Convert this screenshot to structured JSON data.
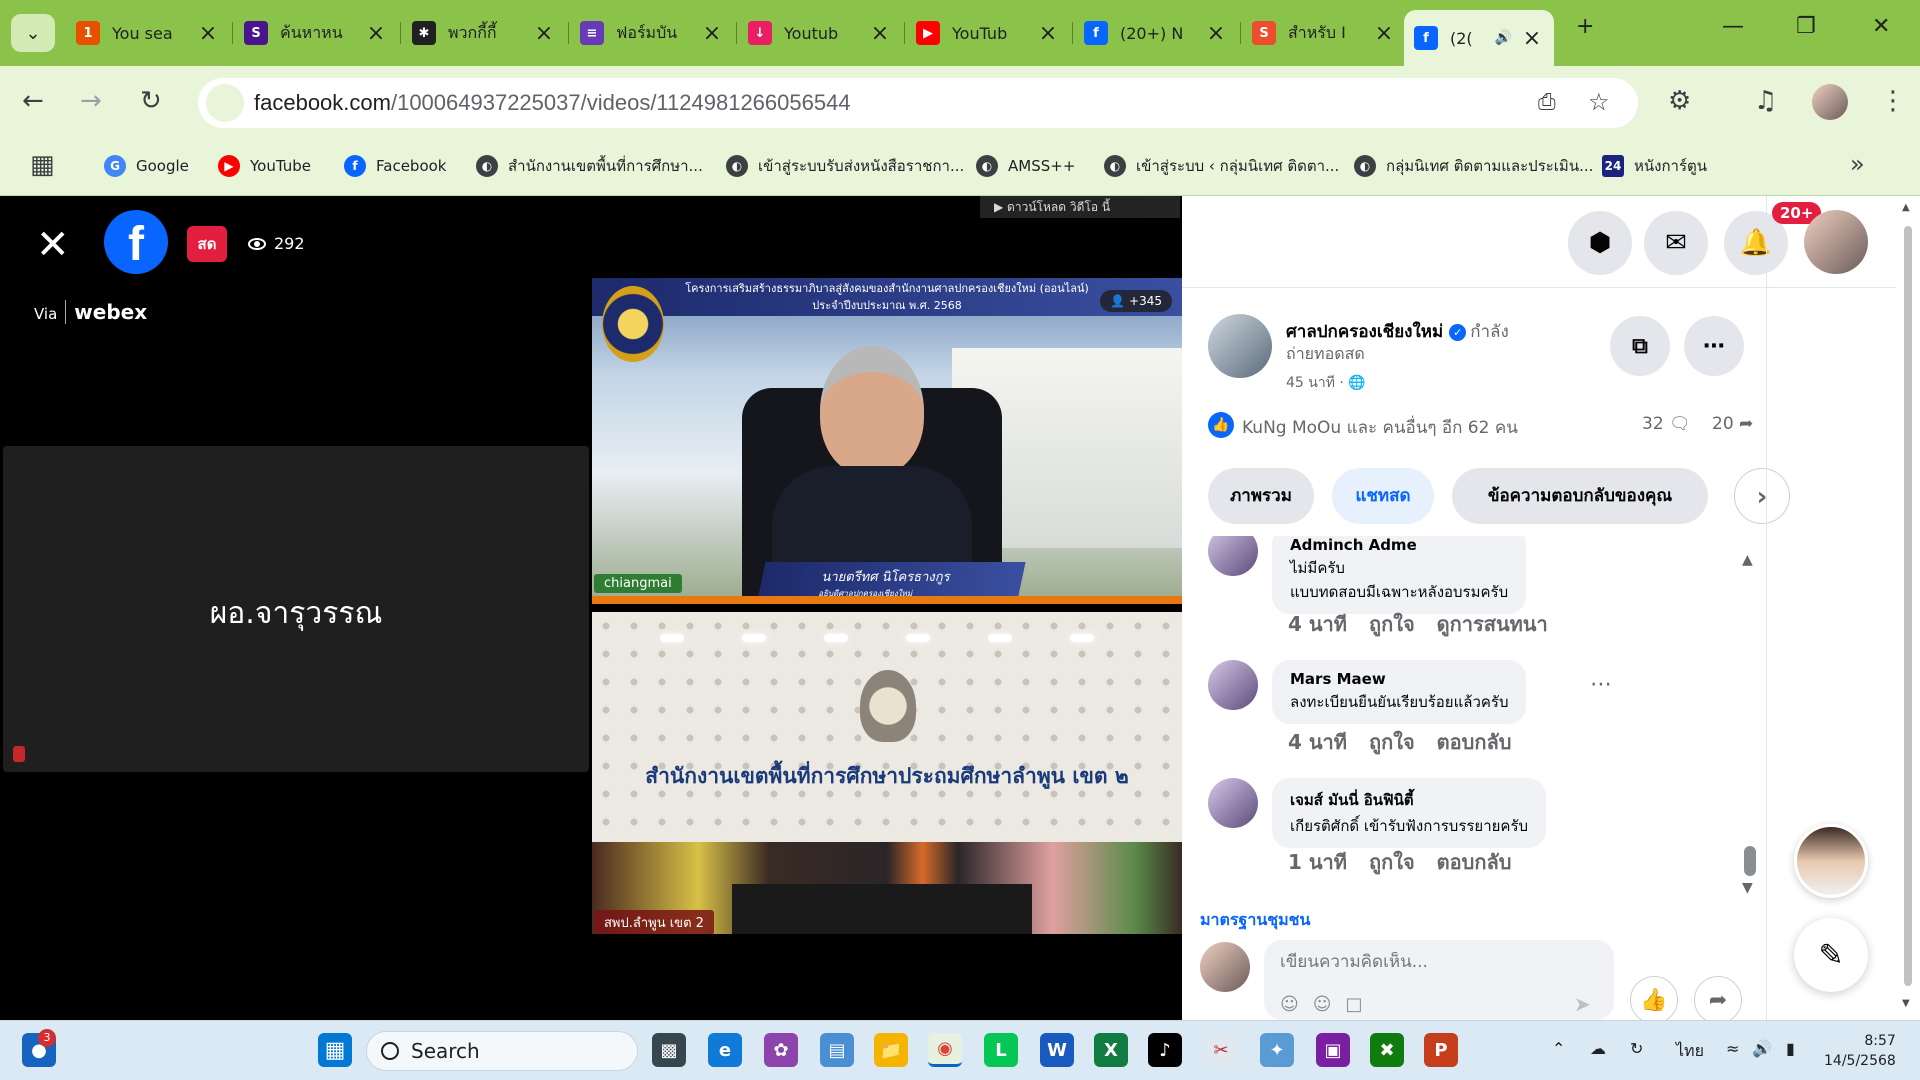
{
  "browser": {
    "tabs": [
      {
        "label": "You sea",
        "icon": "123hd-icon",
        "color": "#e65100"
      },
      {
        "label": "ค้นหาหน",
        "icon": "sd-icon",
        "color": "#4a148c"
      },
      {
        "label": "พวกกี้กี้",
        "icon": "spider-icon",
        "color": "#212121"
      },
      {
        "label": "ฟอร์มบัน",
        "icon": "forms-icon",
        "color": "#673ab7"
      },
      {
        "label": "Youtub",
        "icon": "download-icon",
        "color": "#e91e63"
      },
      {
        "label": "YouTub",
        "icon": "youtube-icon",
        "color": "#ff0000"
      },
      {
        "label": "(20+) N",
        "icon": "facebook-icon",
        "color": "#0866ff"
      },
      {
        "label": "สำหรับ I",
        "icon": "shopee-icon",
        "color": "#ee4d2d"
      },
      {
        "label": "(2(",
        "icon": "facebook-icon",
        "color": "#0866ff"
      }
    ],
    "url_domain": "facebook.com",
    "url_path": "/100064937225037/videos/1124981266056544",
    "bookmarks": [
      {
        "label": "Google",
        "icon": "google-icon",
        "color": "#4285f4"
      },
      {
        "label": "YouTube",
        "icon": "youtube-icon",
        "color": "#ff0000"
      },
      {
        "label": "Facebook",
        "icon": "facebook-icon",
        "color": "#0866ff"
      },
      {
        "label": "สำนักงานเขตพื้นที่การศึกษา...",
        "icon": "globe-icon",
        "color": "#3c4043"
      },
      {
        "label": "เข้าสู่ระบบรับส่งหนังสือราชกา...",
        "icon": "globe-icon",
        "color": "#3c4043"
      },
      {
        "label": "AMSS++",
        "icon": "globe-icon",
        "color": "#3c4043"
      },
      {
        "label": "เข้าสู่ระบบ ‹ กลุ่มนิเทศ ติดตา...",
        "icon": "globe-icon",
        "color": "#3c4043"
      },
      {
        "label": "กลุ่มนิเทศ ติดตามและประเมิน...",
        "icon": "globe-icon",
        "color": "#3c4043"
      },
      {
        "label": "หนังการ์ตูน",
        "icon": "24hd-icon",
        "color": "#1a237e"
      }
    ]
  },
  "video": {
    "live_label": "สด",
    "viewer_count": "292",
    "via_label": "Via",
    "webex_label": "webex",
    "participant_name": "ผอ.จารุวรรณ",
    "download_bar": "ดาวน์โหลด วิดีโอ นี้",
    "top_banner_line1": "โครงการเสริมสร้างธรรมาภิบาลสู่สังคมของสำนักงานศาลปกครองเชียงใหม่ (ออนไลน์)",
    "top_banner_line2": "ประจำปีงบประมาณ พ.ศ. 2568",
    "top_count": "+345",
    "speaker_name": "นายตรีทศ นิโครธางกูร",
    "speaker_title": "อธิบดีศาลปกครองเชียงใหม่",
    "top_location": "chiangmai",
    "bottom_title": "สำนักงานเขตพื้นที่การศึกษาประถมศึกษาลำพูน เขต ๒",
    "bottom_location": "สพป.ลำพูน เขต 2"
  },
  "header": {
    "notif_count": "20+"
  },
  "post": {
    "page_name": "ศาลปกครองเชียงใหม่",
    "status_inline": "กำลัง",
    "status_line2": "ถ่ายทอดสด",
    "time": "45 นาที ·",
    "reactions_text": "KuNg MoOu และ คนอื่นๆ อีก 62 คน",
    "comment_count": "32",
    "share_count": "20",
    "tabs": [
      "ภาพรวม",
      "แชทสด",
      "ข้อความตอบกลับของคุณ"
    ]
  },
  "comments": [
    {
      "author": "Adminch Adme",
      "lines": [
        "ไม่มีครับ",
        "แบบทดสอบมีเฉพาะหลังอบรมครับ"
      ],
      "time": "4 นาที",
      "like": "ถูกใจ",
      "action": "ดูการสนทนา"
    },
    {
      "author": "Mars Maew",
      "lines": [
        "ลงทะเบียนยืนยันเรียบร้อยแล้วครับ"
      ],
      "time": "4 นาที",
      "like": "ถูกใจ",
      "action": "ตอบกลับ"
    },
    {
      "author": "เจมส์ มันนี่ อินฟินิตี้",
      "lines": [
        "เกียรติศักดิ์ เข้ารับฟังการบรรยายครับ"
      ],
      "time": "1 นาที",
      "like": "ถูกใจ",
      "action": "ตอบกลับ"
    }
  ],
  "composer": {
    "standards_link": "มาตรฐานชุมชน",
    "placeholder": "เขียนความคิดเห็น..."
  },
  "taskbar": {
    "search_label": "Search",
    "notif_badge": "3",
    "lang": "ไทย",
    "time": "8:57",
    "date": "14/5/2568"
  }
}
